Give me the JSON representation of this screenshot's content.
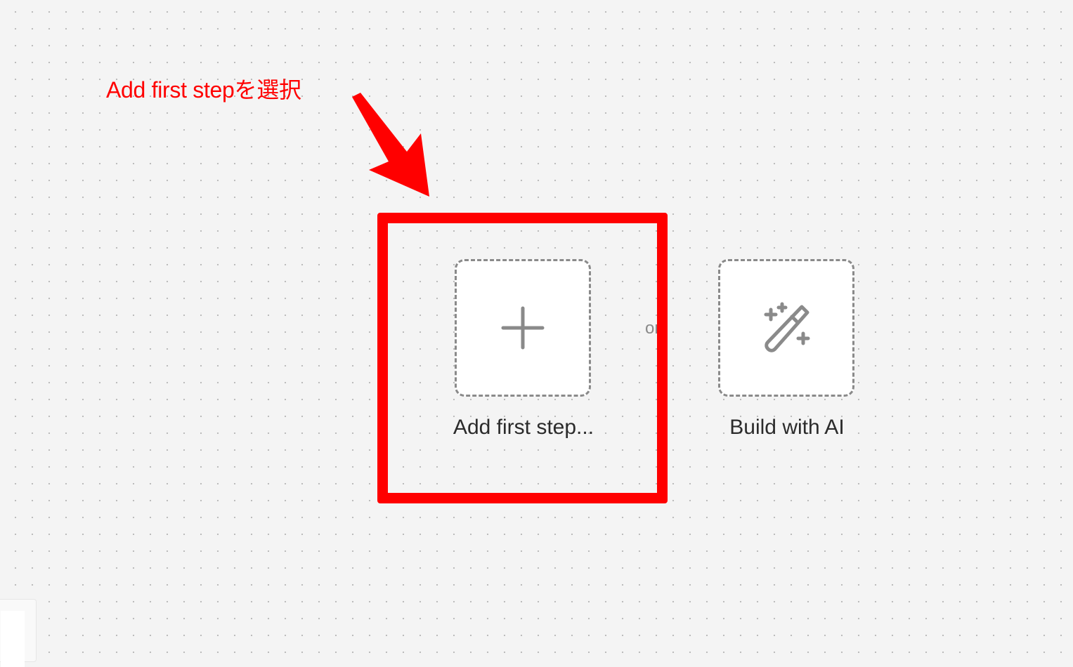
{
  "annotation": {
    "text": "Add first stepを選択",
    "color": "#ff0000"
  },
  "canvas": {
    "background_color": "#f4f4f4",
    "dot_color": "#b9b9b9"
  },
  "actions": {
    "add_first_step": {
      "label": "Add first step...",
      "icon": "plus-icon"
    },
    "separator": "or",
    "build_with_ai": {
      "label": "Build with AI",
      "icon": "magic-wand-icon"
    }
  },
  "colors": {
    "card_border": "#8a8a8a",
    "icon": "#8a8a8a",
    "label": "#2b2b2b"
  }
}
